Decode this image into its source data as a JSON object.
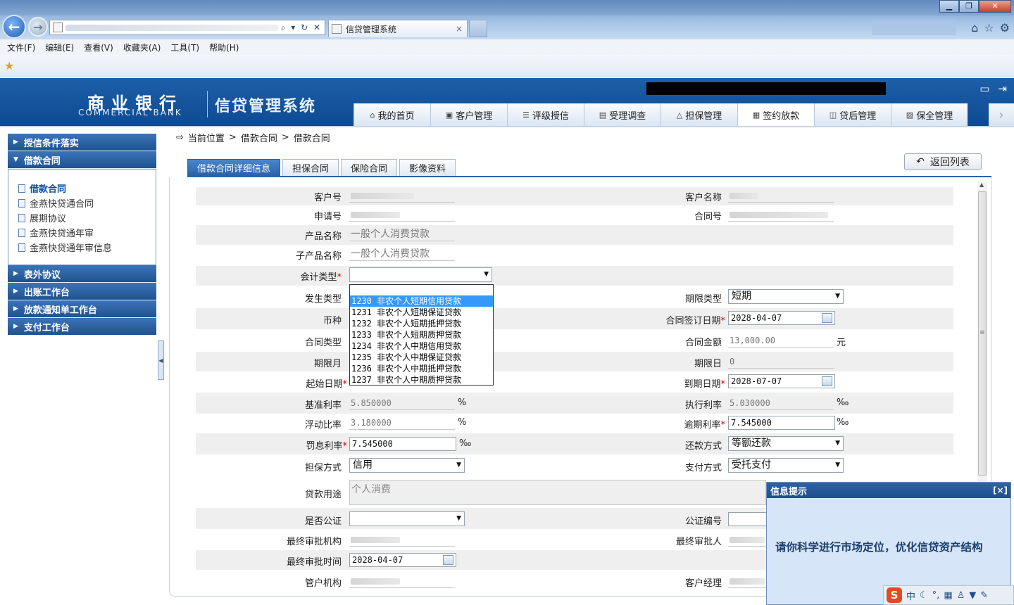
{
  "browser": {
    "tab_title": "信贷管理系统",
    "tab_close": "×",
    "menu": [
      "文件(F)",
      "编辑(E)",
      "查看(V)",
      "收藏夹(A)",
      "工具(T)",
      "帮助(H)"
    ],
    "window_buttons": [
      "▁",
      "❐",
      "✕"
    ]
  },
  "app": {
    "bank_cn": "商业银行",
    "bank_en": "COMMERCIAL BANK",
    "system_title": "信贷管理系统",
    "nav_tabs": [
      "我的首页",
      "客户管理",
      "评级授信",
      "受理调查",
      "担保管理",
      "签约放款",
      "贷后管理",
      "保全管理"
    ],
    "active_tab": "签约放款"
  },
  "sidebar": {
    "sections_top": [
      "授信条件落实",
      "借款合同"
    ],
    "items": [
      "借款合同",
      "金燕快贷通合同",
      "展期协议",
      "金燕快贷通年审",
      "金燕快贷通年审信息"
    ],
    "sections_bottom": [
      "表外协议",
      "出账工作台",
      "放款通知单工作台",
      "支付工作台"
    ]
  },
  "breadcrumb": {
    "label": "当前位置",
    "sep": ">",
    "path1": "借款合同",
    "path2": "借款合同"
  },
  "content_tabs": [
    "借款合同详细信息",
    "担保合同",
    "保险合同",
    "影像资料"
  ],
  "return_button": "返回列表",
  "form": {
    "customer_no_label": "客户号",
    "customer_name_label": "客户名称",
    "application_no_label": "申请号",
    "contract_no_label": "合同号",
    "product_name_label": "产品名称",
    "product_name": "一般个人消费贷款",
    "sub_product_label": "子产品名称",
    "sub_product": "一般个人消费贷款",
    "accounting_type_label": "会计类型",
    "occurrence_type_label": "发生类型",
    "term_type_label": "期限类型",
    "term_type": "短期",
    "currency_label": "币种",
    "sign_date_label": "合同签订日期",
    "sign_date": "2028-04-07",
    "contract_type_label": "合同类型",
    "contract_amount_label": "合同金额",
    "contract_amount": "13,000.00",
    "amount_unit": "元",
    "term_month_label": "期限月",
    "term_day_label": "期限日",
    "term_day": "0",
    "start_date_label": "起始日期",
    "end_date_label": "到期日期",
    "end_date": "2028-07-07",
    "base_rate_label": "基准利率",
    "base_rate": "5.850000",
    "base_rate_unit": "%",
    "exec_rate_label": "执行利率",
    "exec_rate": "5.030000",
    "exec_rate_unit": "‰",
    "float_ratio_label": "浮动比率",
    "float_ratio": "3.180000",
    "float_ratio_unit": "%",
    "overdue_rate_label": "逾期利率",
    "overdue_rate": "7.545000",
    "overdue_rate_unit": "‰",
    "penalty_rate_label": "罚息利率",
    "penalty_rate": "7.545000",
    "penalty_rate_unit": "‰",
    "repay_method_label": "还款方式",
    "repay_method": "等额还款",
    "guarantee_label": "担保方式",
    "guarantee": "信用",
    "payment_label": "支付方式",
    "payment": "受托支付",
    "purpose_label": "贷款用途",
    "purpose": "个人消费",
    "notarized_label": "是否公证",
    "notary_no_label": "公证编号",
    "final_org_label": "最终审批机构",
    "final_person_label": "最终审批人",
    "final_time_label": "最终审批时间",
    "final_time": "2028-04-07",
    "manage_org_label": "管户机构",
    "manager_label": "客户经理"
  },
  "dropdown_options": [
    "1230 非农个人短期信用贷款",
    "1231 非农个人短期保证贷款",
    "1232 非农个人短期抵押贷款",
    "1233 非农个人短期质押贷款",
    "1234 非农个人中期信用贷款",
    "1235 非农个人中期保证贷款",
    "1236 非农个人中期抵押贷款",
    "1237 非农个人中期质押贷款"
  ],
  "notification": {
    "title": "信息提示",
    "close": "[×]",
    "message": "请你科学进行市场定位，优化信贷资产结构"
  },
  "ime": {
    "logo": "S",
    "mode": "中"
  },
  "colors": {
    "header_blue": "#0e4a91",
    "selected_option": "#3399ff",
    "required": "#dd0000"
  }
}
